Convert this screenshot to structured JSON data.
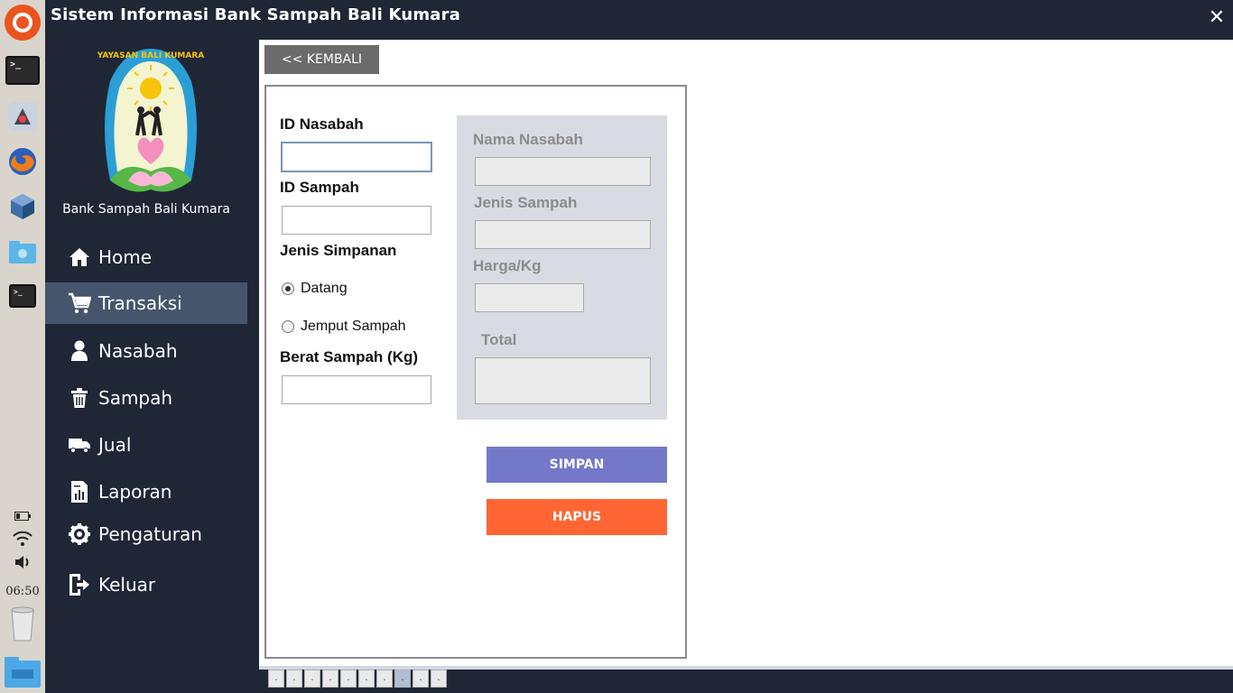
{
  "window": {
    "title": "Sistem Informasi Bank Sampah Bali Kumara",
    "close_symbol": "✕"
  },
  "launcher": {
    "time": "06:50",
    "icons": [
      "ubuntu-logo-icon",
      "terminal-icon",
      "java-app-icon",
      "firefox-icon",
      "virtualbox-icon",
      "downloads-folder-icon",
      "terminal-icon",
      "battery-icon",
      "wifi-icon",
      "volume-icon",
      "trash-icon",
      "files-icon"
    ]
  },
  "sidebar": {
    "logo_text": "YAYASAN BALI KUMARA",
    "brand": "Bank Sampah Bali Kumara",
    "items": [
      {
        "label": "Home",
        "icon": "home-icon"
      },
      {
        "label": "Transaksi",
        "icon": "cart-icon",
        "active": true
      },
      {
        "label": "Nasabah",
        "icon": "user-icon"
      },
      {
        "label": "Sampah",
        "icon": "trash-bin-icon"
      },
      {
        "label": "Jual",
        "icon": "truck-icon"
      },
      {
        "label": "Laporan",
        "icon": "report-icon"
      },
      {
        "label": "Pengaturan",
        "icon": "gear-icon"
      },
      {
        "label": "Keluar",
        "icon": "exit-icon"
      }
    ]
  },
  "main": {
    "back_label": "<< KEMBALI",
    "form": {
      "id_nasabah_label": "ID Nasabah",
      "id_nasabah_value": "",
      "id_sampah_label": "ID Sampah",
      "id_sampah_value": "",
      "jenis_simpanan_label": "Jenis Simpanan",
      "radio_datang": "Datang",
      "radio_jemput": "Jemput Sampah",
      "selected_option": "Datang",
      "berat_label": "Berat Sampah (Kg)",
      "berat_value": ""
    },
    "info": {
      "nama_label": "Nama Nasabah",
      "jenis_label": "Jenis Sampah",
      "harga_label": "Harga/Kg",
      "total_label": "Total"
    },
    "simpan_label": "SIMPAN",
    "hapus_label": "HAPUS",
    "colors": {
      "simpan": "#7478c9",
      "hapus": "#ff6633",
      "sidebar": "#1f2736",
      "active_nav": "#45556c"
    }
  },
  "workspace_tabs": [
    ".",
    ".",
    ".",
    ".",
    ".",
    ".",
    ".",
    ".",
    ".",
    "."
  ]
}
